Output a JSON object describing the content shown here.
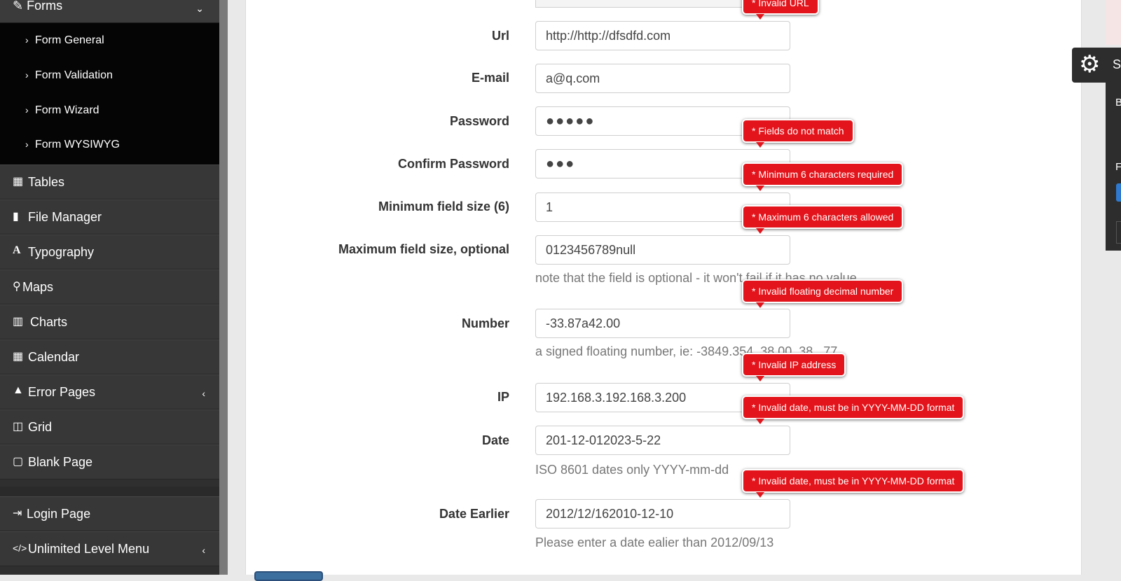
{
  "sidebar": {
    "forms_label": "Forms",
    "forms_sub": [
      "Form General",
      "Form Validation",
      "Form Wizard",
      "Form WYSIWYG"
    ],
    "items": [
      {
        "label": "Tables",
        "icon": "table-icon",
        "glyph": "▦"
      },
      {
        "label": "File Manager",
        "icon": "file-icon",
        "glyph": "▮"
      },
      {
        "label": "Typography",
        "icon": "font-icon",
        "glyph": "A"
      },
      {
        "label": "Maps",
        "icon": "map-marker-icon",
        "glyph": "⚲"
      },
      {
        "label": "Charts",
        "icon": "bar-chart-icon",
        "glyph": "▥"
      },
      {
        "label": "Calendar",
        "icon": "calendar-icon",
        "glyph": "▦"
      },
      {
        "label": "Error Pages",
        "icon": "warning-icon",
        "glyph": "▲"
      },
      {
        "label": "Grid",
        "icon": "columns-icon",
        "glyph": "◫"
      },
      {
        "label": "Blank Page",
        "icon": "square-icon",
        "glyph": "▢"
      }
    ],
    "login": {
      "label": "Login Page",
      "glyph": "⇥"
    },
    "unlimited": {
      "label": "Unlimited Level Menu",
      "glyph": "</>"
    }
  },
  "form": {
    "url": {
      "label": "Url",
      "value": "http://http://dfsdfd.com"
    },
    "email": {
      "label": "E-mail",
      "value": "a@q.com"
    },
    "password": {
      "label": "Password",
      "value": "●●●●●"
    },
    "confirm": {
      "label": "Confirm Password",
      "value": "●●●"
    },
    "min": {
      "label": "Minimum field size (6)",
      "value": "1"
    },
    "max": {
      "label": "Maximum field size, optional",
      "value": "0123456789null",
      "help": "note that the field is optional - it won't fail if it has no value"
    },
    "number": {
      "label": "Number",
      "value": "-33.87a42.00",
      "help": "a signed floating number, ie: -3849.354, 38.00, 38, .77"
    },
    "ip": {
      "label": "IP",
      "value": "192.168.3.192.168.3.200"
    },
    "date": {
      "label": "Date",
      "value": "201-12-012023-5-22",
      "help": "ISO 8601 dates only YYYY-mm-dd"
    },
    "date_earlier": {
      "label": "Date Earlier",
      "value": "2012/12/162010-12-10",
      "help": "Please enter a date ealier than 2012/09/13"
    }
  },
  "errors": {
    "url": "* Invalid URL",
    "confirm": "* Fields do not match",
    "min": "* Minimum 6 characters required",
    "max": "* Maximum 6 characters allowed",
    "number": "* Invalid floating decimal number",
    "ip": "* Invalid IP address",
    "date": "* Invalid date, must be in YYYY-MM-DD format",
    "date_earlier": "* Invalid date, must be in YYYY-MM-DD format"
  },
  "right_panel": {
    "gear_glyph": "⚙",
    "partial_title": "S",
    "partial_1": "B",
    "partial_2": "F"
  },
  "colors": {
    "tooltip": "#e3141b",
    "sidebar": "#373737",
    "submenu": "#050505"
  }
}
